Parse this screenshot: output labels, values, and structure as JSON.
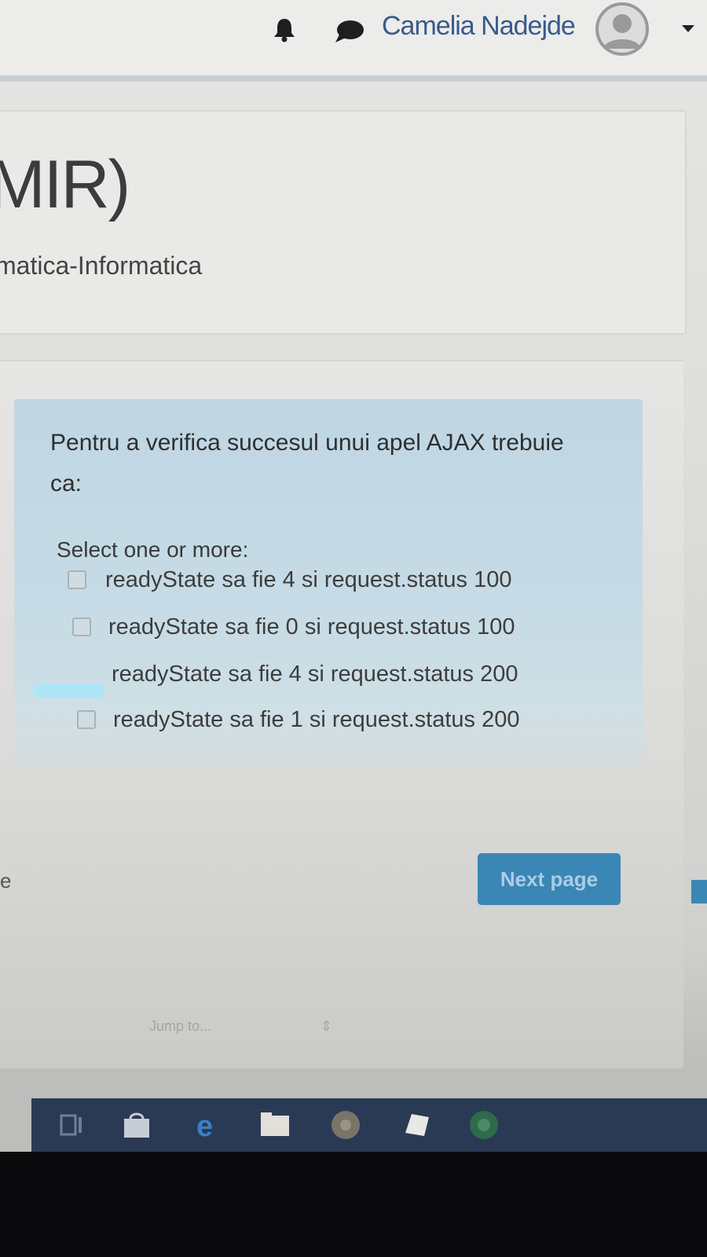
{
  "header": {
    "user_name": "Camelia Nadejde",
    "notification_icon": "bell-icon",
    "messages_icon": "chat-icon",
    "avatar_icon": "user-avatar-icon",
    "menu_icon": "caret-down-icon"
  },
  "course": {
    "title": "MIR)",
    "subtitle": "matica-Informatica"
  },
  "question": {
    "text": "Pentru a verifica succesul unui apel AJAX trebuie ca:",
    "instruction": "Select one or more:",
    "answers": [
      {
        "label": "readyState sa fie 4 si request.status 100"
      },
      {
        "label": "readyState sa fie 0 si request.status 100"
      },
      {
        "label": "readyState sa fie 4 si request.status 200"
      },
      {
        "label": "readyState sa fie 1 si request.status 200"
      }
    ]
  },
  "navigation": {
    "next_label": "Next page",
    "left_fragment": "e"
  },
  "footer_faded": {
    "jump_to": "Jump to..."
  },
  "taskbar": {
    "icons": [
      "task-view-icon",
      "store-icon",
      "edge-icon",
      "file-explorer-icon",
      "chrome-icon",
      "app-icon",
      "app2-icon"
    ]
  },
  "colors": {
    "question_bg": "#c2d8e4",
    "button_bg": "#3a86b5",
    "username": "#3a5a8a"
  }
}
